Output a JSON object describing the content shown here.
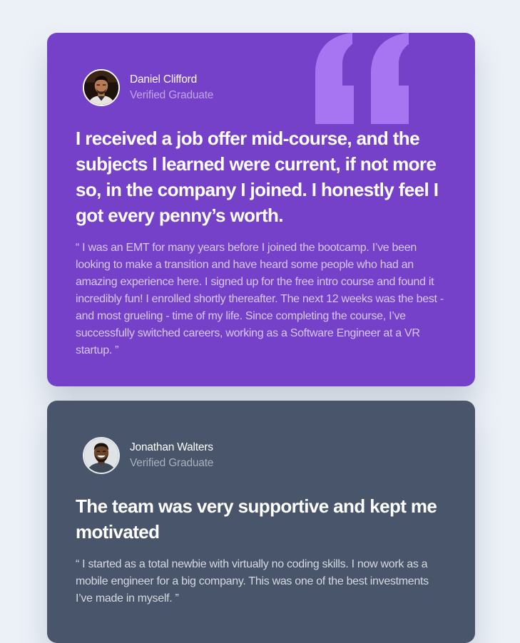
{
  "testimonials": [
    {
      "name": "Daniel Clifford",
      "role": "Verified Graduate",
      "headline": "I received a job offer mid-course, and the subjects I learned were current, if not more so, in the company I joined. I honestly feel I got every penny’s worth.",
      "body": "“ I was an EMT for many years before I joined the bootcamp. I’ve been looking to make a transition and have heard some people who had an amazing experience here. I signed up for the free intro course and found it incredibly fun! I enrolled shortly thereafter. The next 12 weeks was the best - and most grueling - time of my life. Since completing the course, I’ve successfully switched careers, working as a Software Engineer at a VR startup. ”",
      "card_color": "#7541c8",
      "avatar_icon": "avatar-photo-man-icon"
    },
    {
      "name": "Jonathan Walters",
      "role": "Verified Graduate",
      "headline": "The team was very supportive and kept me motivated",
      "body": "“ I started as a total newbie with virtually no coding skills. I now work as a mobile engineer for a big company. This was one of the best investments I’ve made in myself. ”",
      "card_color": "#48556a",
      "avatar_icon": "avatar-photo-smiling-man-icon"
    }
  ],
  "theme": {
    "page_background": "#ecf1f8",
    "quote_mark_color": "#a775f1",
    "quote_icon": "quotation-mark-icon"
  }
}
